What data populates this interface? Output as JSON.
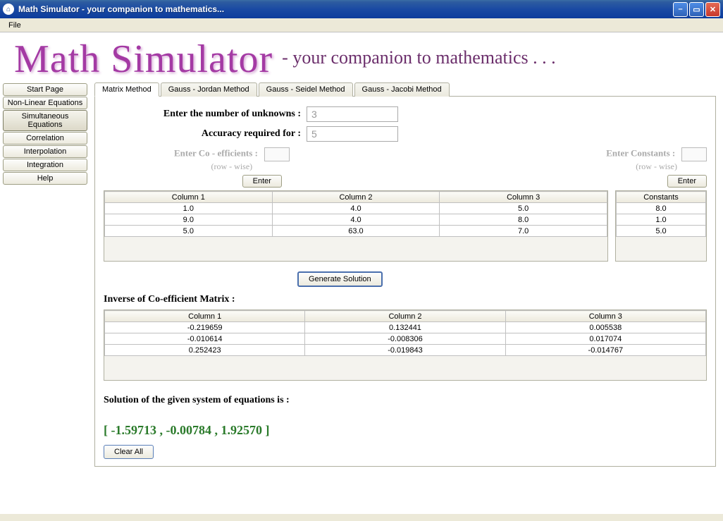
{
  "window": {
    "title": "Math Simulator - your companion to mathematics..."
  },
  "menubar": {
    "file": "File"
  },
  "banner": {
    "main": "Math Simulator",
    "sub": "- your companion to mathematics . . ."
  },
  "sidebar": {
    "items": [
      {
        "label": "Start Page"
      },
      {
        "label": "Non-Linear Equations"
      },
      {
        "label": "Simultaneous Equations"
      },
      {
        "label": "Correlation"
      },
      {
        "label": "Interpolation"
      },
      {
        "label": "Integration"
      },
      {
        "label": "Help"
      }
    ],
    "active_index": 2
  },
  "tabs": {
    "items": [
      {
        "label": "Matrix Method"
      },
      {
        "label": "Gauss - Jordan Method"
      },
      {
        "label": "Gauss - Seidel Method"
      },
      {
        "label": "Gauss - Jacobi Method"
      }
    ],
    "active_index": 0
  },
  "form": {
    "unknowns_label": "Enter the number of unknowns :",
    "unknowns_value": "3",
    "accuracy_label": "Accuracy required for :",
    "accuracy_value": "5",
    "coeff_title": "Enter Co - efficients  :",
    "coeff_sub": "(row - wise)",
    "const_title": "Enter Constants :",
    "const_sub": "(row - wise)",
    "enter_btn": "Enter"
  },
  "coeff_table": {
    "headers": [
      "Column 1",
      "Column 2",
      "Column 3"
    ],
    "rows": [
      [
        "1.0",
        "4.0",
        "5.0"
      ],
      [
        "9.0",
        "4.0",
        "8.0"
      ],
      [
        "5.0",
        "63.0",
        "7.0"
      ]
    ]
  },
  "const_table": {
    "header": "Constants",
    "rows": [
      "8.0",
      "1.0",
      "5.0"
    ]
  },
  "generate_btn": "Generate Solution",
  "inverse": {
    "title": "Inverse of Co-efficient Matrix :",
    "headers": [
      "Column 1",
      "Column 2",
      "Column 3"
    ],
    "rows": [
      [
        "-0.219659",
        "0.132441",
        "0.005538"
      ],
      [
        "-0.010614",
        "-0.008306",
        "0.017074"
      ],
      [
        "0.252423",
        "-0.019843",
        "-0.014767"
      ]
    ]
  },
  "solution": {
    "label": "Solution of the given system of equations is :",
    "value": "[ -1.59713 , -0.00784 , 1.92570 ]"
  },
  "clear_btn": "Clear All"
}
